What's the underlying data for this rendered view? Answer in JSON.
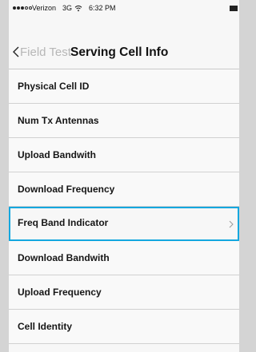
{
  "status_bar": {
    "carrier": "Verizon",
    "network": "3G",
    "time": "6:32 PM",
    "signal_icon": "signal-dots",
    "wifi_icon": "wifi-icon",
    "battery_icon": "battery-icon"
  },
  "nav": {
    "back_label": "Field Test",
    "title": "Serving Cell Info"
  },
  "list": {
    "items": [
      {
        "label": "Physical Cell ID"
      },
      {
        "label": "Num Tx Antennas"
      },
      {
        "label": "Upload Bandwith"
      },
      {
        "label": "Download Frequency"
      },
      {
        "label": "Freq Band Indicator",
        "selected": true
      },
      {
        "label": "Download Bandwith"
      },
      {
        "label": "Upload Frequency"
      },
      {
        "label": "Cell Identity"
      }
    ]
  },
  "colors": {
    "background": "#d4d4d4",
    "screen": "#f7f7f7",
    "selection_border": "#14a7df",
    "text": "#161616",
    "back_text": "#b7b7b7"
  }
}
